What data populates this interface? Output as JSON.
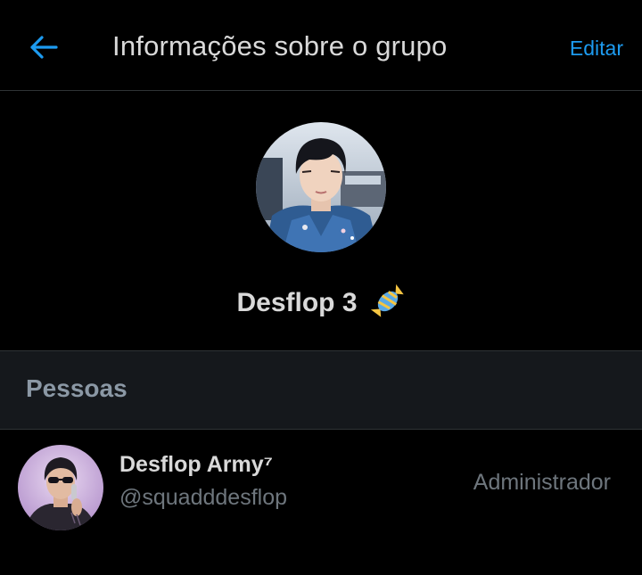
{
  "header": {
    "title": "Informações sobre o grupo",
    "edit_label": "Editar",
    "back_icon": "arrow-left-icon",
    "accent_color": "#1d9bf0"
  },
  "group": {
    "name": "Desflop 3",
    "emoji_icon": "candy-icon"
  },
  "people_section": {
    "title": "Pessoas",
    "members": [
      {
        "name": "Desflop Army⁷",
        "handle": "@squadddesflop",
        "role": "Administrador"
      }
    ]
  }
}
